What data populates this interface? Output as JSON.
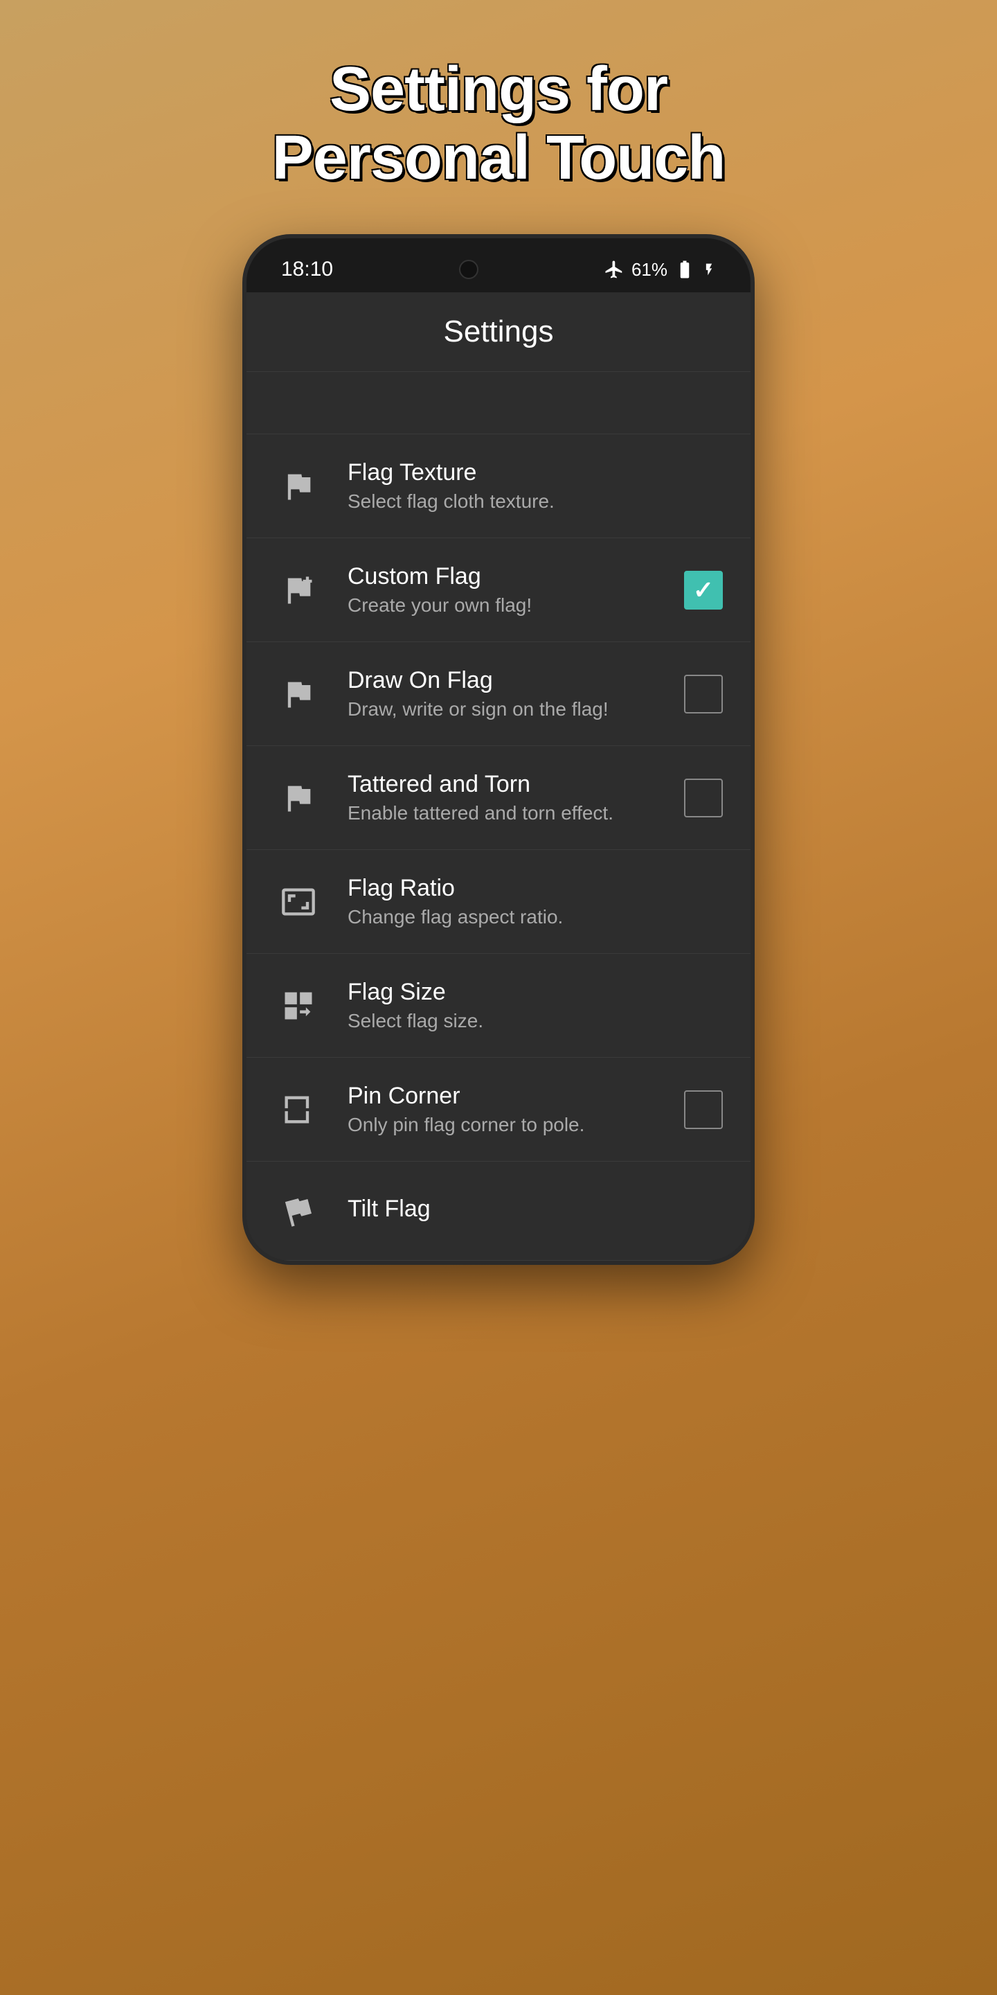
{
  "page": {
    "title_line1": "Settings for",
    "title_line2": "Personal Touch"
  },
  "status_bar": {
    "time": "18:10",
    "battery": "61%"
  },
  "app_bar": {
    "title": "Settings"
  },
  "settings": {
    "items": [
      {
        "id": "flag-texture",
        "title": "Flag Texture",
        "subtitle": "Select flag cloth texture.",
        "has_checkbox": false,
        "checked": false,
        "icon": "flag-texture-icon"
      },
      {
        "id": "custom-flag",
        "title": "Custom Flag",
        "subtitle": "Create your own flag!",
        "has_checkbox": true,
        "checked": true,
        "icon": "custom-flag-icon"
      },
      {
        "id": "draw-on-flag",
        "title": "Draw On Flag",
        "subtitle": "Draw, write or sign on the flag!",
        "has_checkbox": true,
        "checked": false,
        "icon": "draw-flag-icon"
      },
      {
        "id": "tattered-torn",
        "title": "Tattered and Torn",
        "subtitle": "Enable tattered and torn effect.",
        "has_checkbox": true,
        "checked": false,
        "icon": "tattered-flag-icon"
      },
      {
        "id": "flag-ratio",
        "title": "Flag Ratio",
        "subtitle": "Change flag aspect ratio.",
        "has_checkbox": false,
        "checked": false,
        "icon": "aspect-ratio-icon"
      },
      {
        "id": "flag-size",
        "title": "Flag Size",
        "subtitle": "Select flag size.",
        "has_checkbox": false,
        "checked": false,
        "icon": "flag-size-icon"
      },
      {
        "id": "pin-corner",
        "title": "Pin Corner",
        "subtitle": "Only pin flag corner to pole.",
        "has_checkbox": true,
        "checked": false,
        "icon": "pin-corner-icon"
      },
      {
        "id": "tilt-flag",
        "title": "Tilt Flag",
        "subtitle": "",
        "has_checkbox": false,
        "checked": false,
        "icon": "tilt-flag-icon"
      }
    ]
  }
}
